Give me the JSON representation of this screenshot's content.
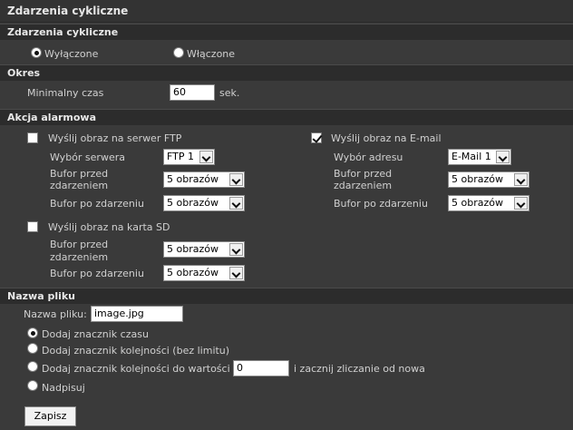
{
  "page_title": "Zdarzenia cykliczne",
  "sections": {
    "cyclic": "Zdarzenia cykliczne",
    "period": "Okres",
    "alarm": "Akcja alarmowa",
    "filename": "Nazwa pliku"
  },
  "cyclic": {
    "off_label": "Wyłączone",
    "on_label": "Włączone",
    "selected": "off"
  },
  "period": {
    "min_time_label": "Minimalny czas",
    "min_time_value": "60",
    "unit": "sek."
  },
  "alarm": {
    "ftp": {
      "checkbox_label": "Wyślij obraz na serwer FTP",
      "checked": false,
      "server_label": "Wybór serwera",
      "server_value": "FTP 1",
      "pre_buffer_label_1": "Bufor przed",
      "pre_buffer_label_2": "zdarzeniem",
      "pre_buffer_value": "5 obrazów",
      "post_buffer_label": "Bufor po zdarzeniu",
      "post_buffer_value": "5 obrazów"
    },
    "email": {
      "checkbox_label": "Wyślij obraz na E-mail",
      "checked": true,
      "address_label": "Wybór adresu",
      "address_value": "E-Mail 1",
      "pre_buffer_label_1": "Bufor przed",
      "pre_buffer_label_2": "zdarzeniem",
      "pre_buffer_value": "5 obrazów",
      "post_buffer_label": "Bufor po zdarzeniu",
      "post_buffer_value": "5 obrazów"
    },
    "sd": {
      "checkbox_label": "Wyślij obraz na karta SD",
      "checked": false,
      "pre_buffer_label_1": "Bufor przed",
      "pre_buffer_label_2": "zdarzeniem",
      "pre_buffer_value": "5 obrazów",
      "post_buffer_label": "Bufor po zdarzeniu",
      "post_buffer_value": "5 obrazów"
    }
  },
  "filename": {
    "label": "Nazwa pliku:",
    "value": "image.jpg",
    "opt_timestamp": "Dodaj znacznik czasu",
    "opt_sequence": "Dodaj znacznik kolejności (bez limitu)",
    "opt_sequence_to": "Dodaj znacznik kolejności do wartości",
    "sequence_to_value": "0",
    "opt_sequence_suffix": "i zacznij zliczanie od nowa",
    "opt_overwrite": "Nadpisuj",
    "selected": "timestamp"
  },
  "save_label": "Zapisz"
}
